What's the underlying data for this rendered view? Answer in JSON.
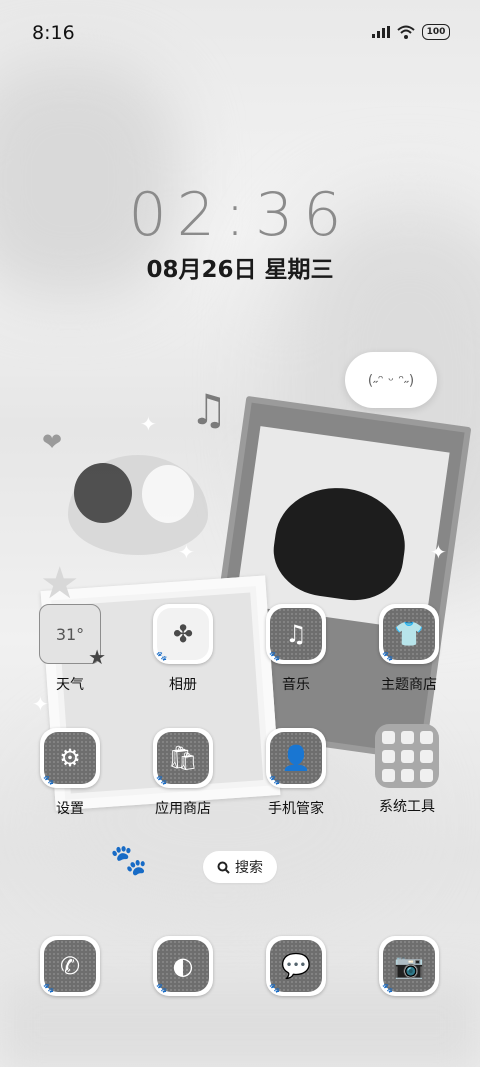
{
  "status_bar": {
    "time": "8:16",
    "battery": "100"
  },
  "lock_widget": {
    "clock": "02:36",
    "date": "08月26日 星期三"
  },
  "weather": {
    "temperature": "31°"
  },
  "apps": [
    {
      "label": "天气"
    },
    {
      "label": "相册"
    },
    {
      "label": "音乐"
    },
    {
      "label": "主题商店"
    },
    {
      "label": "设置"
    },
    {
      "label": "应用商店"
    },
    {
      "label": "手机管家"
    },
    {
      "label": "系统工具"
    }
  ],
  "search": {
    "label": "搜索"
  },
  "dock": [
    {
      "icon": "phone-icon"
    },
    {
      "icon": "browser-icon"
    },
    {
      "icon": "messages-icon"
    },
    {
      "icon": "camera-icon"
    }
  ],
  "decor": {
    "cloud_face": "(˶ᵔ ᵕ ᵔ˶)"
  }
}
